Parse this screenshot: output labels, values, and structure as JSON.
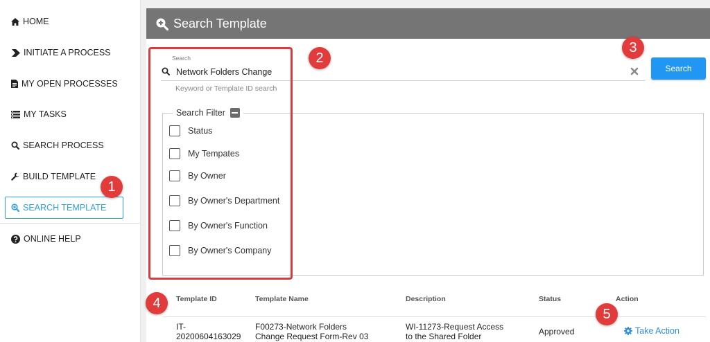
{
  "sidebar": {
    "items": [
      {
        "label": "HOME",
        "icon": "home-icon"
      },
      {
        "label": "INITIATE A PROCESS",
        "icon": "chevron-right-icon"
      },
      {
        "label": "MY OPEN PROCESSES",
        "icon": "document-icon"
      },
      {
        "label": "MY TASKS",
        "icon": "tasks-icon"
      },
      {
        "label": "SEARCH PROCESS",
        "icon": "search-icon"
      },
      {
        "label": "BUILD TEMPLATE",
        "icon": "wrench-icon"
      },
      {
        "label": "SEARCH TEMPLATE",
        "icon": "zoom-in-icon",
        "active": true
      },
      {
        "label": "ONLINE HELP",
        "icon": "help-icon"
      }
    ]
  },
  "header": {
    "title": "Search Template",
    "icon": "zoom-in-icon"
  },
  "search": {
    "label": "Search",
    "value": "Network Folders Change",
    "hint": "Keyword or Template ID search",
    "button": "Search"
  },
  "filter": {
    "legend": "Search Filter",
    "options": [
      "Status",
      "My Tempates",
      "By Owner",
      "By Owner's Department",
      "By Owner's Function",
      "By Owner's Company"
    ]
  },
  "table": {
    "headers": [
      "Template ID",
      "Template Name",
      "Description",
      "Status",
      "Action"
    ],
    "rows": [
      {
        "id_line1": "IT-",
        "id_line2": "20200604163029",
        "name_line1": "F00273-Network Folders",
        "name_line2": "Change Request Form-Rev 03",
        "desc_line1": "WI-11273-Request Access",
        "desc_line2": "to the Shared Folder",
        "status": "Approved",
        "action": "Take Action"
      }
    ]
  },
  "annotations": [
    "1",
    "2",
    "3",
    "4",
    "5"
  ],
  "colors": {
    "accent": "#2196f3",
    "header": "#757575",
    "annotation": "#e23b3b"
  }
}
